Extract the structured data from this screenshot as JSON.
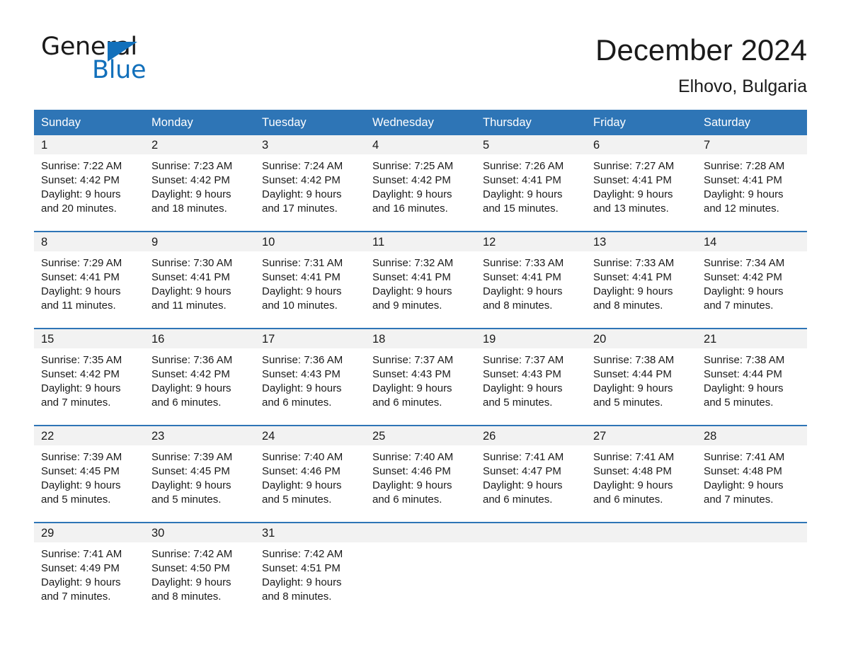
{
  "brand": {
    "name_part1": "General",
    "name_part2": "Blue",
    "triangle_color": "#1270bb"
  },
  "header": {
    "month_title": "December 2024",
    "location": "Elhovo, Bulgaria",
    "header_bg_color": "#2e75b6",
    "daynum_bg_color": "#f2f2f2"
  },
  "weekdays": [
    "Sunday",
    "Monday",
    "Tuesday",
    "Wednesday",
    "Thursday",
    "Friday",
    "Saturday"
  ],
  "weeks": [
    [
      {
        "day": "1",
        "sunrise": "Sunrise: 7:22 AM",
        "sunset": "Sunset: 4:42 PM",
        "daylight1": "Daylight: 9 hours",
        "daylight2": "and 20 minutes."
      },
      {
        "day": "2",
        "sunrise": "Sunrise: 7:23 AM",
        "sunset": "Sunset: 4:42 PM",
        "daylight1": "Daylight: 9 hours",
        "daylight2": "and 18 minutes."
      },
      {
        "day": "3",
        "sunrise": "Sunrise: 7:24 AM",
        "sunset": "Sunset: 4:42 PM",
        "daylight1": "Daylight: 9 hours",
        "daylight2": "and 17 minutes."
      },
      {
        "day": "4",
        "sunrise": "Sunrise: 7:25 AM",
        "sunset": "Sunset: 4:42 PM",
        "daylight1": "Daylight: 9 hours",
        "daylight2": "and 16 minutes."
      },
      {
        "day": "5",
        "sunrise": "Sunrise: 7:26 AM",
        "sunset": "Sunset: 4:41 PM",
        "daylight1": "Daylight: 9 hours",
        "daylight2": "and 15 minutes."
      },
      {
        "day": "6",
        "sunrise": "Sunrise: 7:27 AM",
        "sunset": "Sunset: 4:41 PM",
        "daylight1": "Daylight: 9 hours",
        "daylight2": "and 13 minutes."
      },
      {
        "day": "7",
        "sunrise": "Sunrise: 7:28 AM",
        "sunset": "Sunset: 4:41 PM",
        "daylight1": "Daylight: 9 hours",
        "daylight2": "and 12 minutes."
      }
    ],
    [
      {
        "day": "8",
        "sunrise": "Sunrise: 7:29 AM",
        "sunset": "Sunset: 4:41 PM",
        "daylight1": "Daylight: 9 hours",
        "daylight2": "and 11 minutes."
      },
      {
        "day": "9",
        "sunrise": "Sunrise: 7:30 AM",
        "sunset": "Sunset: 4:41 PM",
        "daylight1": "Daylight: 9 hours",
        "daylight2": "and 11 minutes."
      },
      {
        "day": "10",
        "sunrise": "Sunrise: 7:31 AM",
        "sunset": "Sunset: 4:41 PM",
        "daylight1": "Daylight: 9 hours",
        "daylight2": "and 10 minutes."
      },
      {
        "day": "11",
        "sunrise": "Sunrise: 7:32 AM",
        "sunset": "Sunset: 4:41 PM",
        "daylight1": "Daylight: 9 hours",
        "daylight2": "and 9 minutes."
      },
      {
        "day": "12",
        "sunrise": "Sunrise: 7:33 AM",
        "sunset": "Sunset: 4:41 PM",
        "daylight1": "Daylight: 9 hours",
        "daylight2": "and 8 minutes."
      },
      {
        "day": "13",
        "sunrise": "Sunrise: 7:33 AM",
        "sunset": "Sunset: 4:41 PM",
        "daylight1": "Daylight: 9 hours",
        "daylight2": "and 8 minutes."
      },
      {
        "day": "14",
        "sunrise": "Sunrise: 7:34 AM",
        "sunset": "Sunset: 4:42 PM",
        "daylight1": "Daylight: 9 hours",
        "daylight2": "and 7 minutes."
      }
    ],
    [
      {
        "day": "15",
        "sunrise": "Sunrise: 7:35 AM",
        "sunset": "Sunset: 4:42 PM",
        "daylight1": "Daylight: 9 hours",
        "daylight2": "and 7 minutes."
      },
      {
        "day": "16",
        "sunrise": "Sunrise: 7:36 AM",
        "sunset": "Sunset: 4:42 PM",
        "daylight1": "Daylight: 9 hours",
        "daylight2": "and 6 minutes."
      },
      {
        "day": "17",
        "sunrise": "Sunrise: 7:36 AM",
        "sunset": "Sunset: 4:43 PM",
        "daylight1": "Daylight: 9 hours",
        "daylight2": "and 6 minutes."
      },
      {
        "day": "18",
        "sunrise": "Sunrise: 7:37 AM",
        "sunset": "Sunset: 4:43 PM",
        "daylight1": "Daylight: 9 hours",
        "daylight2": "and 6 minutes."
      },
      {
        "day": "19",
        "sunrise": "Sunrise: 7:37 AM",
        "sunset": "Sunset: 4:43 PM",
        "daylight1": "Daylight: 9 hours",
        "daylight2": "and 5 minutes."
      },
      {
        "day": "20",
        "sunrise": "Sunrise: 7:38 AM",
        "sunset": "Sunset: 4:44 PM",
        "daylight1": "Daylight: 9 hours",
        "daylight2": "and 5 minutes."
      },
      {
        "day": "21",
        "sunrise": "Sunrise: 7:38 AM",
        "sunset": "Sunset: 4:44 PM",
        "daylight1": "Daylight: 9 hours",
        "daylight2": "and 5 minutes."
      }
    ],
    [
      {
        "day": "22",
        "sunrise": "Sunrise: 7:39 AM",
        "sunset": "Sunset: 4:45 PM",
        "daylight1": "Daylight: 9 hours",
        "daylight2": "and 5 minutes."
      },
      {
        "day": "23",
        "sunrise": "Sunrise: 7:39 AM",
        "sunset": "Sunset: 4:45 PM",
        "daylight1": "Daylight: 9 hours",
        "daylight2": "and 5 minutes."
      },
      {
        "day": "24",
        "sunrise": "Sunrise: 7:40 AM",
        "sunset": "Sunset: 4:46 PM",
        "daylight1": "Daylight: 9 hours",
        "daylight2": "and 5 minutes."
      },
      {
        "day": "25",
        "sunrise": "Sunrise: 7:40 AM",
        "sunset": "Sunset: 4:46 PM",
        "daylight1": "Daylight: 9 hours",
        "daylight2": "and 6 minutes."
      },
      {
        "day": "26",
        "sunrise": "Sunrise: 7:41 AM",
        "sunset": "Sunset: 4:47 PM",
        "daylight1": "Daylight: 9 hours",
        "daylight2": "and 6 minutes."
      },
      {
        "day": "27",
        "sunrise": "Sunrise: 7:41 AM",
        "sunset": "Sunset: 4:48 PM",
        "daylight1": "Daylight: 9 hours",
        "daylight2": "and 6 minutes."
      },
      {
        "day": "28",
        "sunrise": "Sunrise: 7:41 AM",
        "sunset": "Sunset: 4:48 PM",
        "daylight1": "Daylight: 9 hours",
        "daylight2": "and 7 minutes."
      }
    ],
    [
      {
        "day": "29",
        "sunrise": "Sunrise: 7:41 AM",
        "sunset": "Sunset: 4:49 PM",
        "daylight1": "Daylight: 9 hours",
        "daylight2": "and 7 minutes."
      },
      {
        "day": "30",
        "sunrise": "Sunrise: 7:42 AM",
        "sunset": "Sunset: 4:50 PM",
        "daylight1": "Daylight: 9 hours",
        "daylight2": "and 8 minutes."
      },
      {
        "day": "31",
        "sunrise": "Sunrise: 7:42 AM",
        "sunset": "Sunset: 4:51 PM",
        "daylight1": "Daylight: 9 hours",
        "daylight2": "and 8 minutes."
      },
      {
        "day": "",
        "sunrise": "",
        "sunset": "",
        "daylight1": "",
        "daylight2": ""
      },
      {
        "day": "",
        "sunrise": "",
        "sunset": "",
        "daylight1": "",
        "daylight2": ""
      },
      {
        "day": "",
        "sunrise": "",
        "sunset": "",
        "daylight1": "",
        "daylight2": ""
      },
      {
        "day": "",
        "sunrise": "",
        "sunset": "",
        "daylight1": "",
        "daylight2": ""
      }
    ]
  ]
}
